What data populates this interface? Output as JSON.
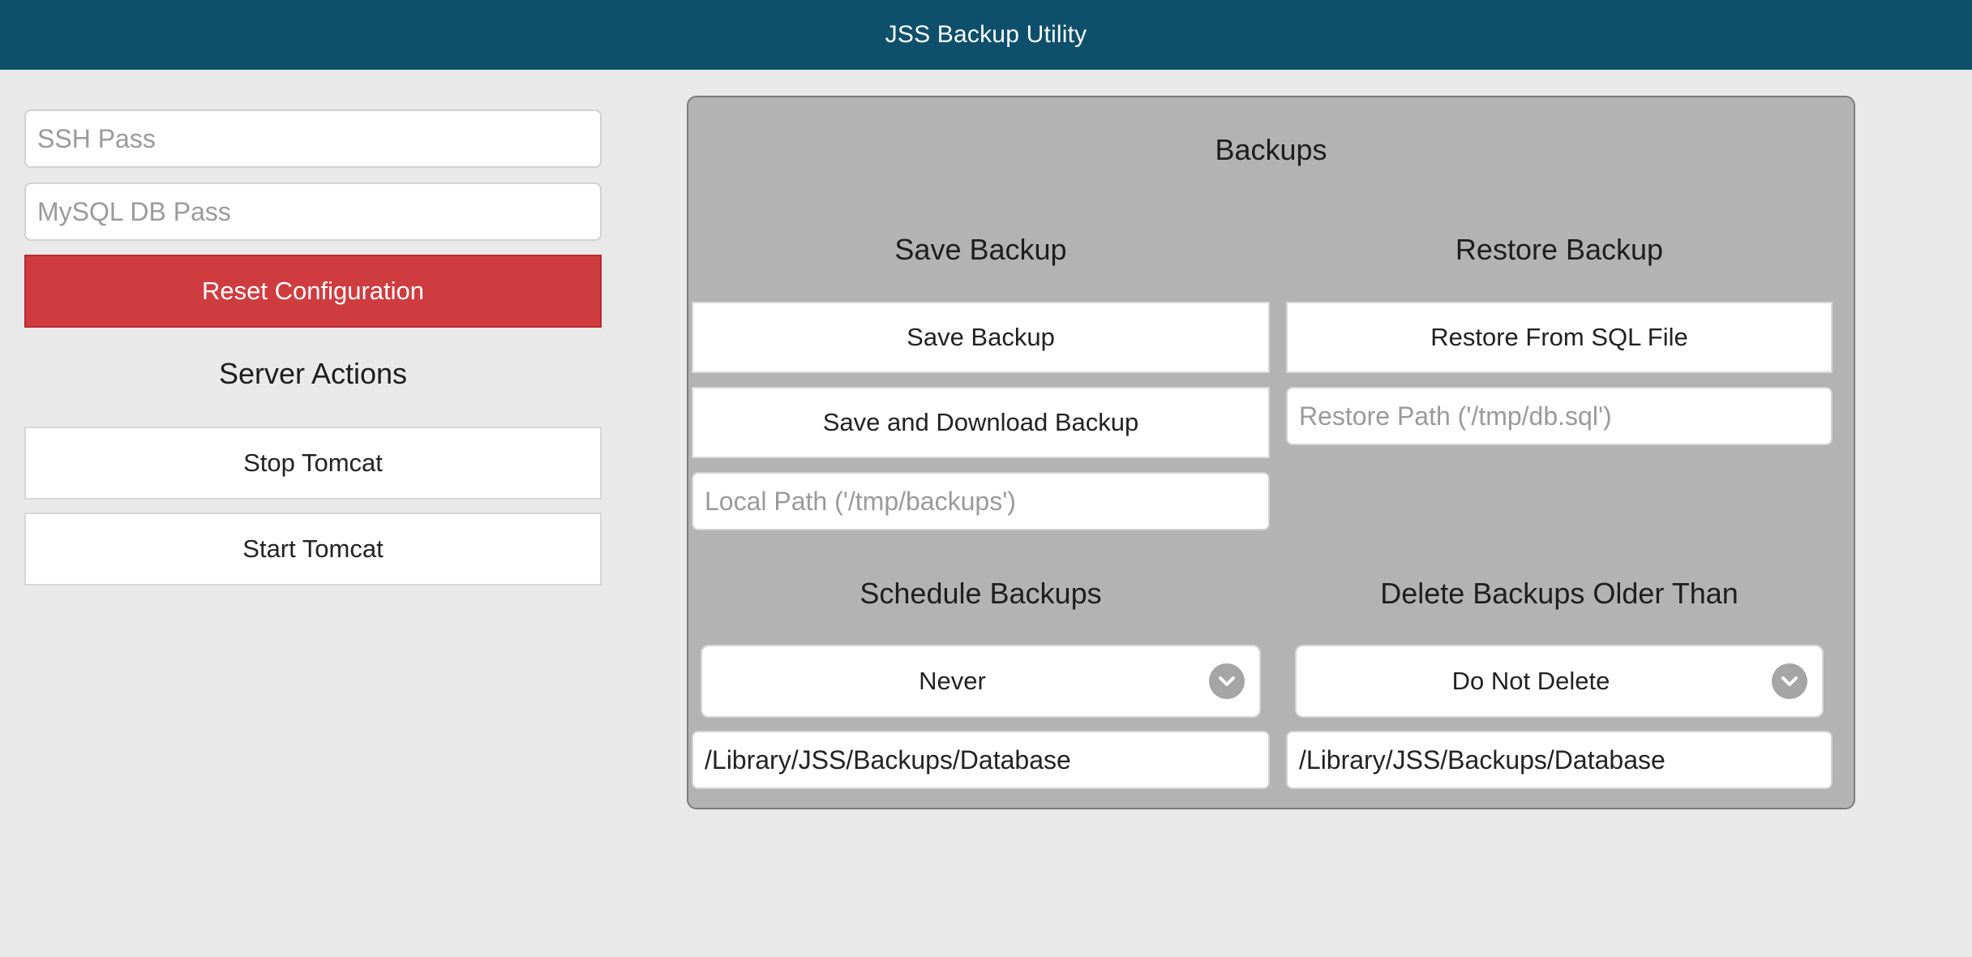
{
  "app": {
    "title": "JSS Backup Utility"
  },
  "sidebar": {
    "ssh_pass_placeholder": "SSH Pass",
    "mysql_pass_placeholder": "MySQL DB Pass",
    "reset_label": "Reset Configuration",
    "server_actions_heading": "Server Actions",
    "stop_tomcat_label": "Stop Tomcat",
    "start_tomcat_label": "Start Tomcat"
  },
  "backups": {
    "heading": "Backups",
    "save": {
      "heading": "Save Backup",
      "save_label": "Save Backup",
      "save_download_label": "Save and Download Backup",
      "local_path_placeholder": "Local Path ('/tmp/backups')"
    },
    "restore": {
      "heading": "Restore Backup",
      "restore_label": "Restore From SQL File",
      "restore_path_placeholder": "Restore Path ('/tmp/db.sql')"
    },
    "schedule": {
      "heading": "Schedule Backups",
      "selected": "Never",
      "path_value": "/Library/JSS/Backups/Database"
    },
    "delete": {
      "heading": "Delete Backups Older Than",
      "selected": "Do Not Delete",
      "path_value": "/Library/JSS/Backups/Database"
    }
  },
  "colors": {
    "header": "#0e4f6b",
    "danger": "#cf3c40",
    "panel": "#b3b3b3",
    "background": "#e9e9e9"
  }
}
